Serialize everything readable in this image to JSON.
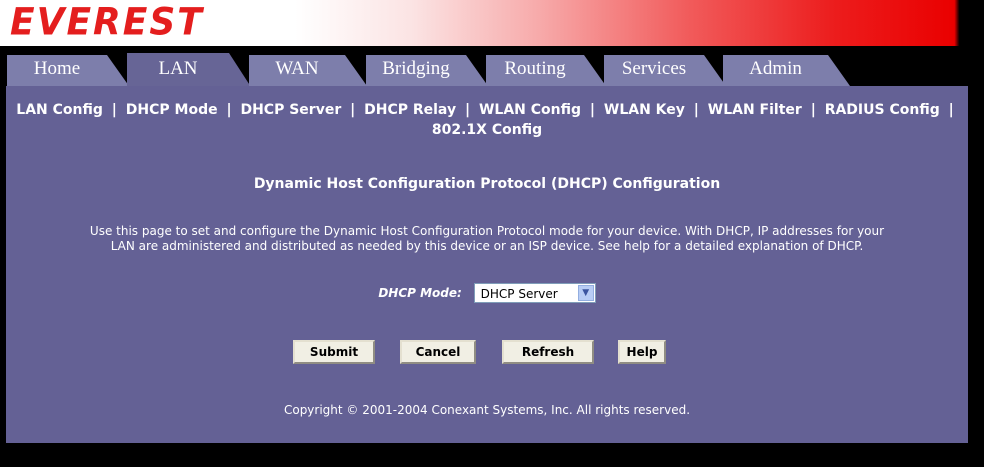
{
  "brand": {
    "logo_text": "EVEREST"
  },
  "tabs": [
    {
      "label": "Home",
      "active": false
    },
    {
      "label": "LAN",
      "active": true
    },
    {
      "label": "WAN",
      "active": false
    },
    {
      "label": "Bridging",
      "active": false
    },
    {
      "label": "Routing",
      "active": false
    },
    {
      "label": "Services",
      "active": false
    },
    {
      "label": "Admin",
      "active": false
    }
  ],
  "subnav": {
    "items": [
      "LAN Config",
      "DHCP Mode",
      "DHCP Server",
      "DHCP Relay",
      "WLAN Config",
      "WLAN Key",
      "WLAN Filter",
      "RADIUS Config",
      "802.1X Config"
    ],
    "separator": "|"
  },
  "page": {
    "title": "Dynamic Host Configuration Protocol (DHCP) Configuration",
    "description_line1": "Use this page to set and configure the Dynamic Host Configuration Protocol mode for your device. With DHCP, IP addresses for your",
    "description_line2": "LAN are administered and distributed as needed by this device or an ISP device. See help for a detailed explanation of DHCP.",
    "dhcp_mode_label": "DHCP Mode:",
    "dhcp_mode_value": "DHCP Server"
  },
  "buttons": {
    "submit": "Submit",
    "cancel": "Cancel",
    "refresh": "Refresh",
    "help": "Help"
  },
  "footer": {
    "copyright": "Copyright © 2001-2004 Conexant Systems, Inc. All rights reserved."
  },
  "colors": {
    "panel": "#646195",
    "tab": "#7d7eab",
    "logo": "#e41e1e"
  }
}
